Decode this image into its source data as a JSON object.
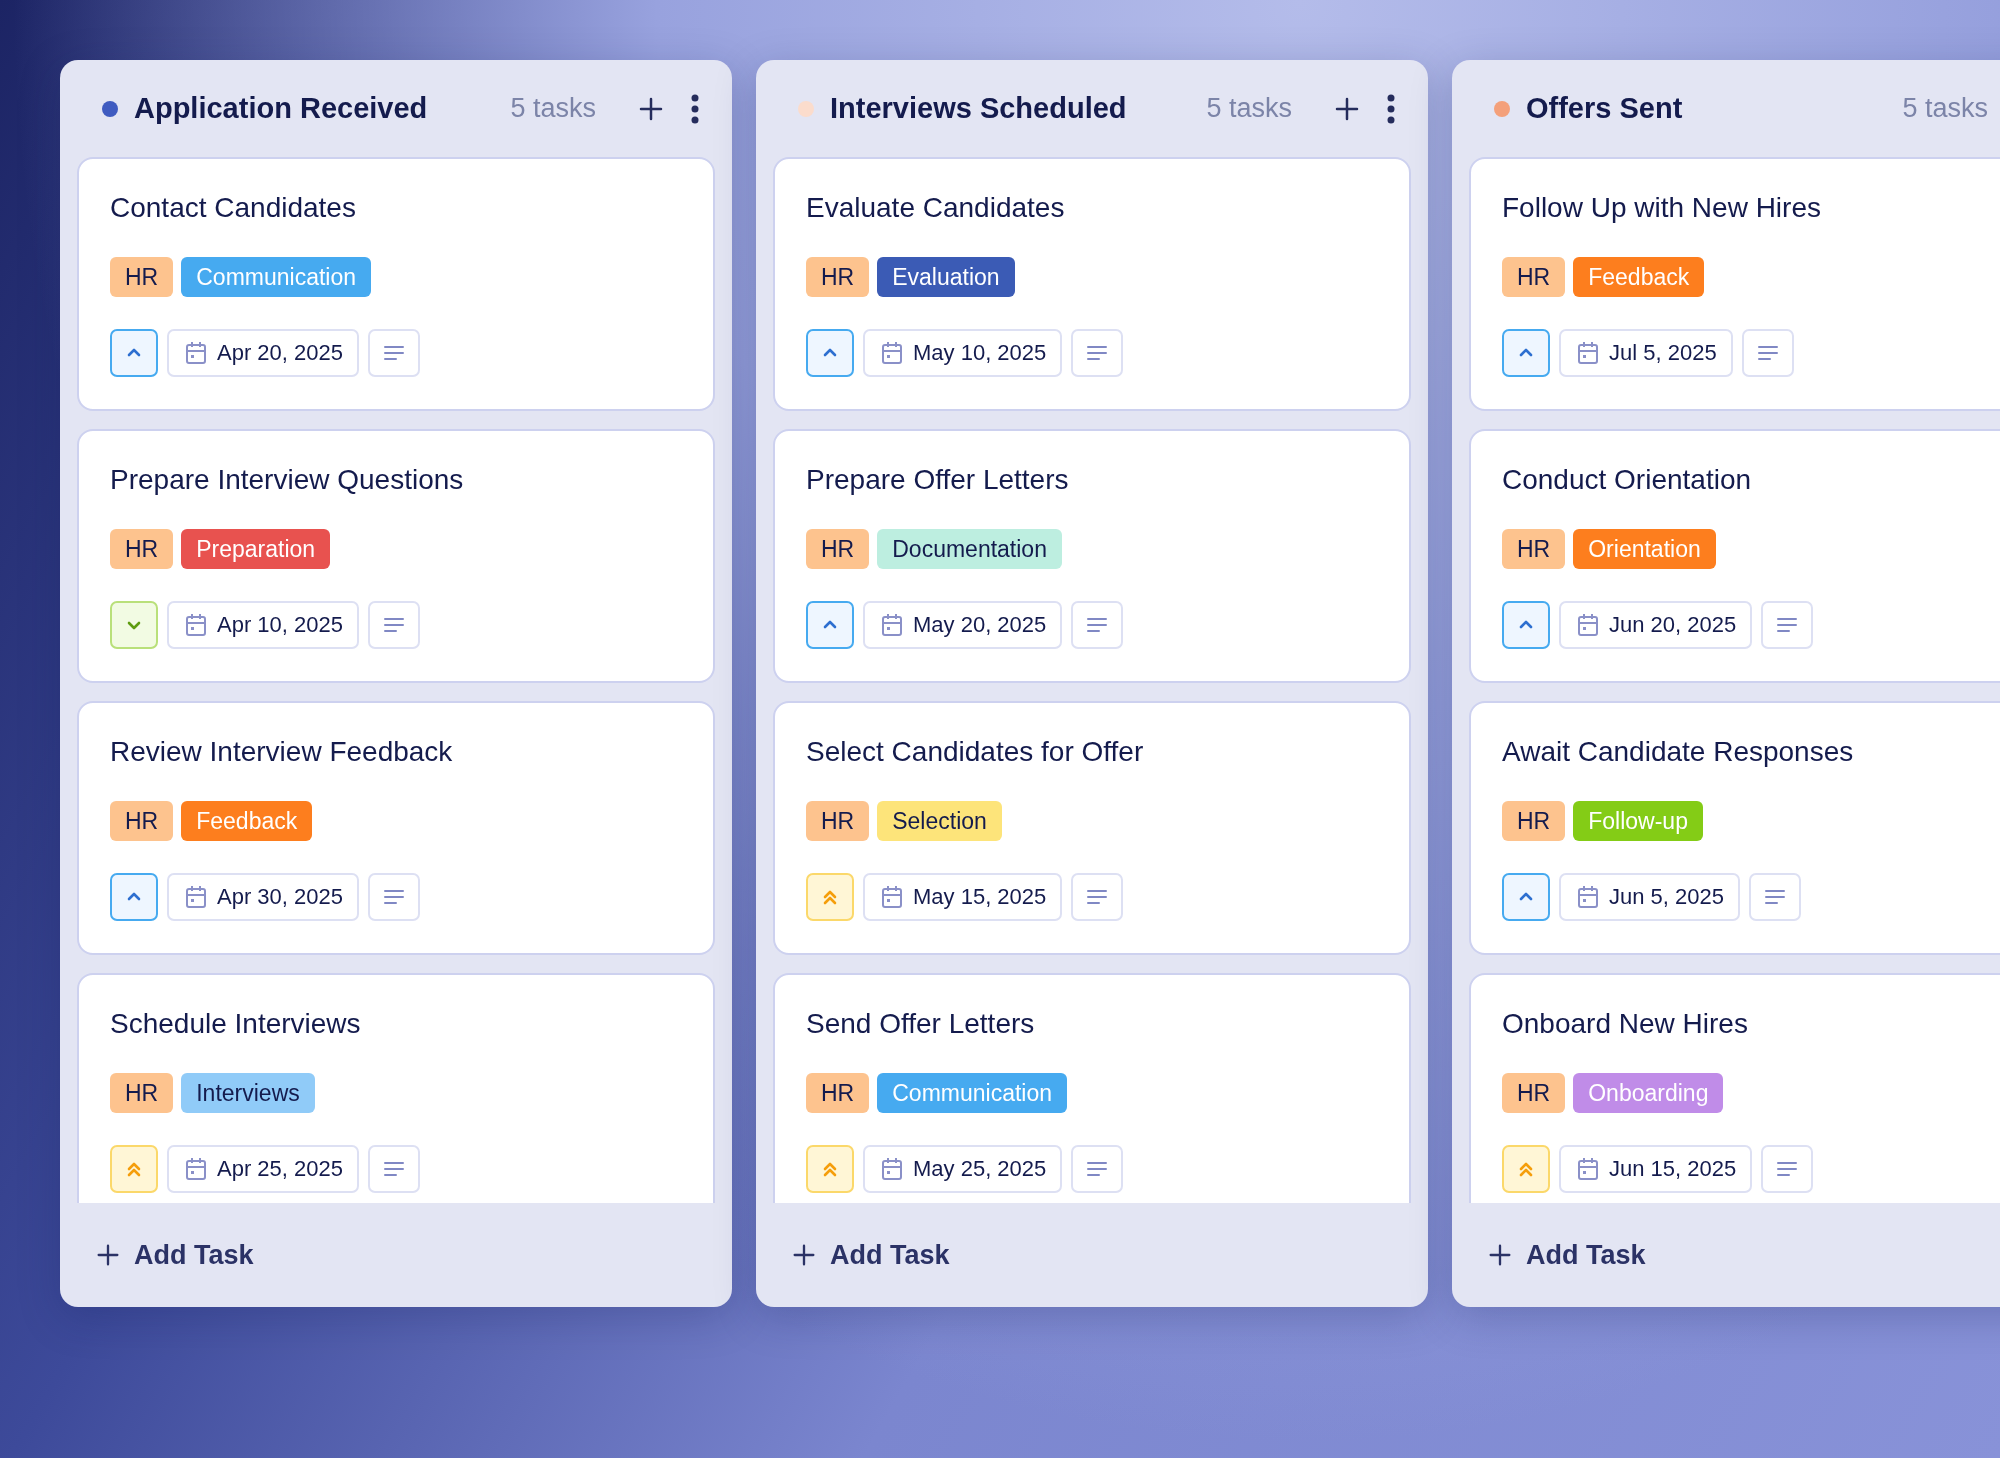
{
  "columns": [
    {
      "title": "Application Received",
      "color": "#3f5bc0",
      "count": "5 tasks",
      "add_label": "Add Task",
      "cards": [
        {
          "title": "Contact Candidates",
          "tags": [
            {
              "label": "HR",
              "color": "#fdc38e"
            },
            {
              "label": "Communication",
              "color": "#46aaf0"
            }
          ],
          "priority": {
            "kind": "high"
          },
          "date": "Apr 20, 2025"
        },
        {
          "title": "Prepare Interview Questions",
          "tags": [
            {
              "label": "HR",
              "color": "#fdc38e"
            },
            {
              "label": "Preparation",
              "color": "#e8524f"
            }
          ],
          "priority": {
            "kind": "low"
          },
          "date": "Apr 10, 2025"
        },
        {
          "title": "Review Interview Feedback",
          "tags": [
            {
              "label": "HR",
              "color": "#fdc38e"
            },
            {
              "label": "Feedback",
              "color": "#fd7e1e"
            }
          ],
          "priority": {
            "kind": "high"
          },
          "date": "Apr 30, 2025"
        },
        {
          "title": "Schedule Interviews",
          "tags": [
            {
              "label": "HR",
              "color": "#fdc38e"
            },
            {
              "label": "Interviews",
              "color": "#90cbf8"
            }
          ],
          "priority": {
            "kind": "urgent"
          },
          "date": "Apr 25, 2025"
        }
      ]
    },
    {
      "title": "Interviews Scheduled",
      "color": "#fbdccc",
      "count": "5 tasks",
      "add_label": "Add Task",
      "cards": [
        {
          "title": "Evaluate Candidates",
          "tags": [
            {
              "label": "HR",
              "color": "#fdc38e"
            },
            {
              "label": "Evaluation",
              "color": "#3b5bb5"
            }
          ],
          "priority": {
            "kind": "high"
          },
          "date": "May 10, 2025"
        },
        {
          "title": "Prepare Offer Letters",
          "tags": [
            {
              "label": "HR",
              "color": "#fdc38e"
            },
            {
              "label": "Documentation",
              "color": "#bdeee0"
            }
          ],
          "priority": {
            "kind": "high"
          },
          "date": "May 20, 2025"
        },
        {
          "title": "Select Candidates for Offer",
          "tags": [
            {
              "label": "HR",
              "color": "#fdc38e"
            },
            {
              "label": "Selection",
              "color": "#fde47a"
            }
          ],
          "priority": {
            "kind": "urgent"
          },
          "date": "May 15, 2025"
        },
        {
          "title": "Send Offer Letters",
          "tags": [
            {
              "label": "HR",
              "color": "#fdc38e"
            },
            {
              "label": "Communication",
              "color": "#46aaf0"
            }
          ],
          "priority": {
            "kind": "urgent"
          },
          "date": "May 25, 2025"
        }
      ]
    },
    {
      "title": "Offers Sent",
      "color": "#f4a07a",
      "count": "5 tasks",
      "add_label": "Add Task",
      "cards": [
        {
          "title": "Follow Up with New Hires",
          "tags": [
            {
              "label": "HR",
              "color": "#fdc38e"
            },
            {
              "label": "Feedback",
              "color": "#fd7e1e"
            }
          ],
          "priority": {
            "kind": "high"
          },
          "date": "Jul 5, 2025"
        },
        {
          "title": "Conduct Orientation",
          "tags": [
            {
              "label": "HR",
              "color": "#fdc38e"
            },
            {
              "label": "Orientation",
              "color": "#fd7e1e"
            }
          ],
          "priority": {
            "kind": "high"
          },
          "date": "Jun 20, 2025"
        },
        {
          "title": "Await Candidate Responses",
          "tags": [
            {
              "label": "HR",
              "color": "#fdc38e"
            },
            {
              "label": "Follow-up",
              "color": "#84cc16"
            }
          ],
          "priority": {
            "kind": "high"
          },
          "date": "Jun 5, 2025"
        },
        {
          "title": "Onboard New Hires",
          "tags": [
            {
              "label": "HR",
              "color": "#fdc38e"
            },
            {
              "label": "Onboarding",
              "color": "#c08ce8"
            }
          ],
          "priority": {
            "kind": "urgent"
          },
          "date": "Jun 15, 2025"
        }
      ]
    }
  ]
}
